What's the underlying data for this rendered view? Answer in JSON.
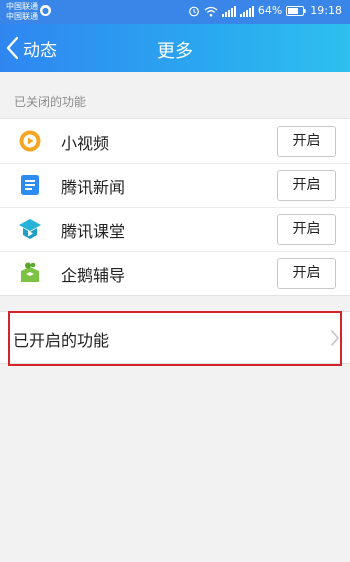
{
  "status_bar": {
    "carrier_1": "中国联通",
    "carrier_2": "中国联通",
    "battery": "64%",
    "time": "19:18",
    "icons": [
      "alarm-icon",
      "wifi-icon",
      "signal-icon",
      "battery-icon"
    ]
  },
  "nav": {
    "back_label": "动态",
    "title": "更多"
  },
  "closed_section": {
    "label": "已关闭的功能",
    "items": [
      {
        "label": "小视频",
        "icon": "video-icon",
        "button": "开启"
      },
      {
        "label": "腾讯新闻",
        "icon": "news-icon",
        "button": "开启"
      },
      {
        "label": "腾讯课堂",
        "icon": "classroom-icon",
        "button": "开启"
      },
      {
        "label": "企鹅辅导",
        "icon": "tutor-icon",
        "button": "开启"
      }
    ]
  },
  "enabled_section": {
    "label": "已开启的功能"
  },
  "colors": {
    "nav_blue": "#2f86f0",
    "highlight_red": "#d4232b",
    "video_orange": "#f5a623",
    "news_blue": "#2d8cf0",
    "classroom_teal": "#27b3d8",
    "tutor_green": "#7cc243"
  }
}
